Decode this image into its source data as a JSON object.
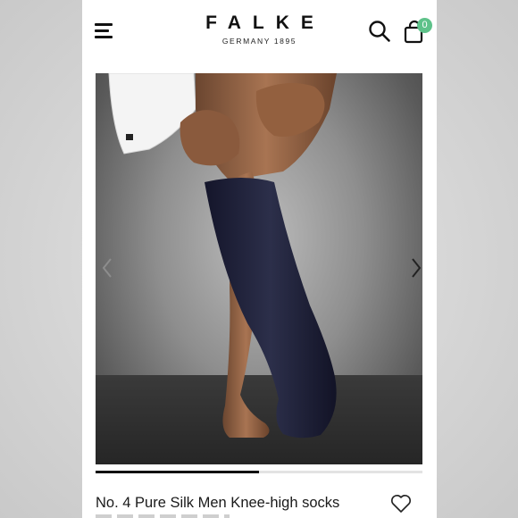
{
  "header": {
    "brand": "FALKE",
    "brand_sub": "GERMANY 1895",
    "cart_count": "0"
  },
  "icons": {
    "menu": "hamburger-menu-icon",
    "search": "search-icon",
    "cart": "shopping-bag-icon",
    "prev": "chevron-left-icon",
    "next": "chevron-right-icon",
    "wishlist": "heart-icon"
  },
  "gallery": {
    "progress_fraction": 0.5
  },
  "product": {
    "title": "No. 4 Pure Silk Men Knee-high socks"
  },
  "colors": {
    "accent_badge": "#5ec28a",
    "text": "#111111"
  }
}
